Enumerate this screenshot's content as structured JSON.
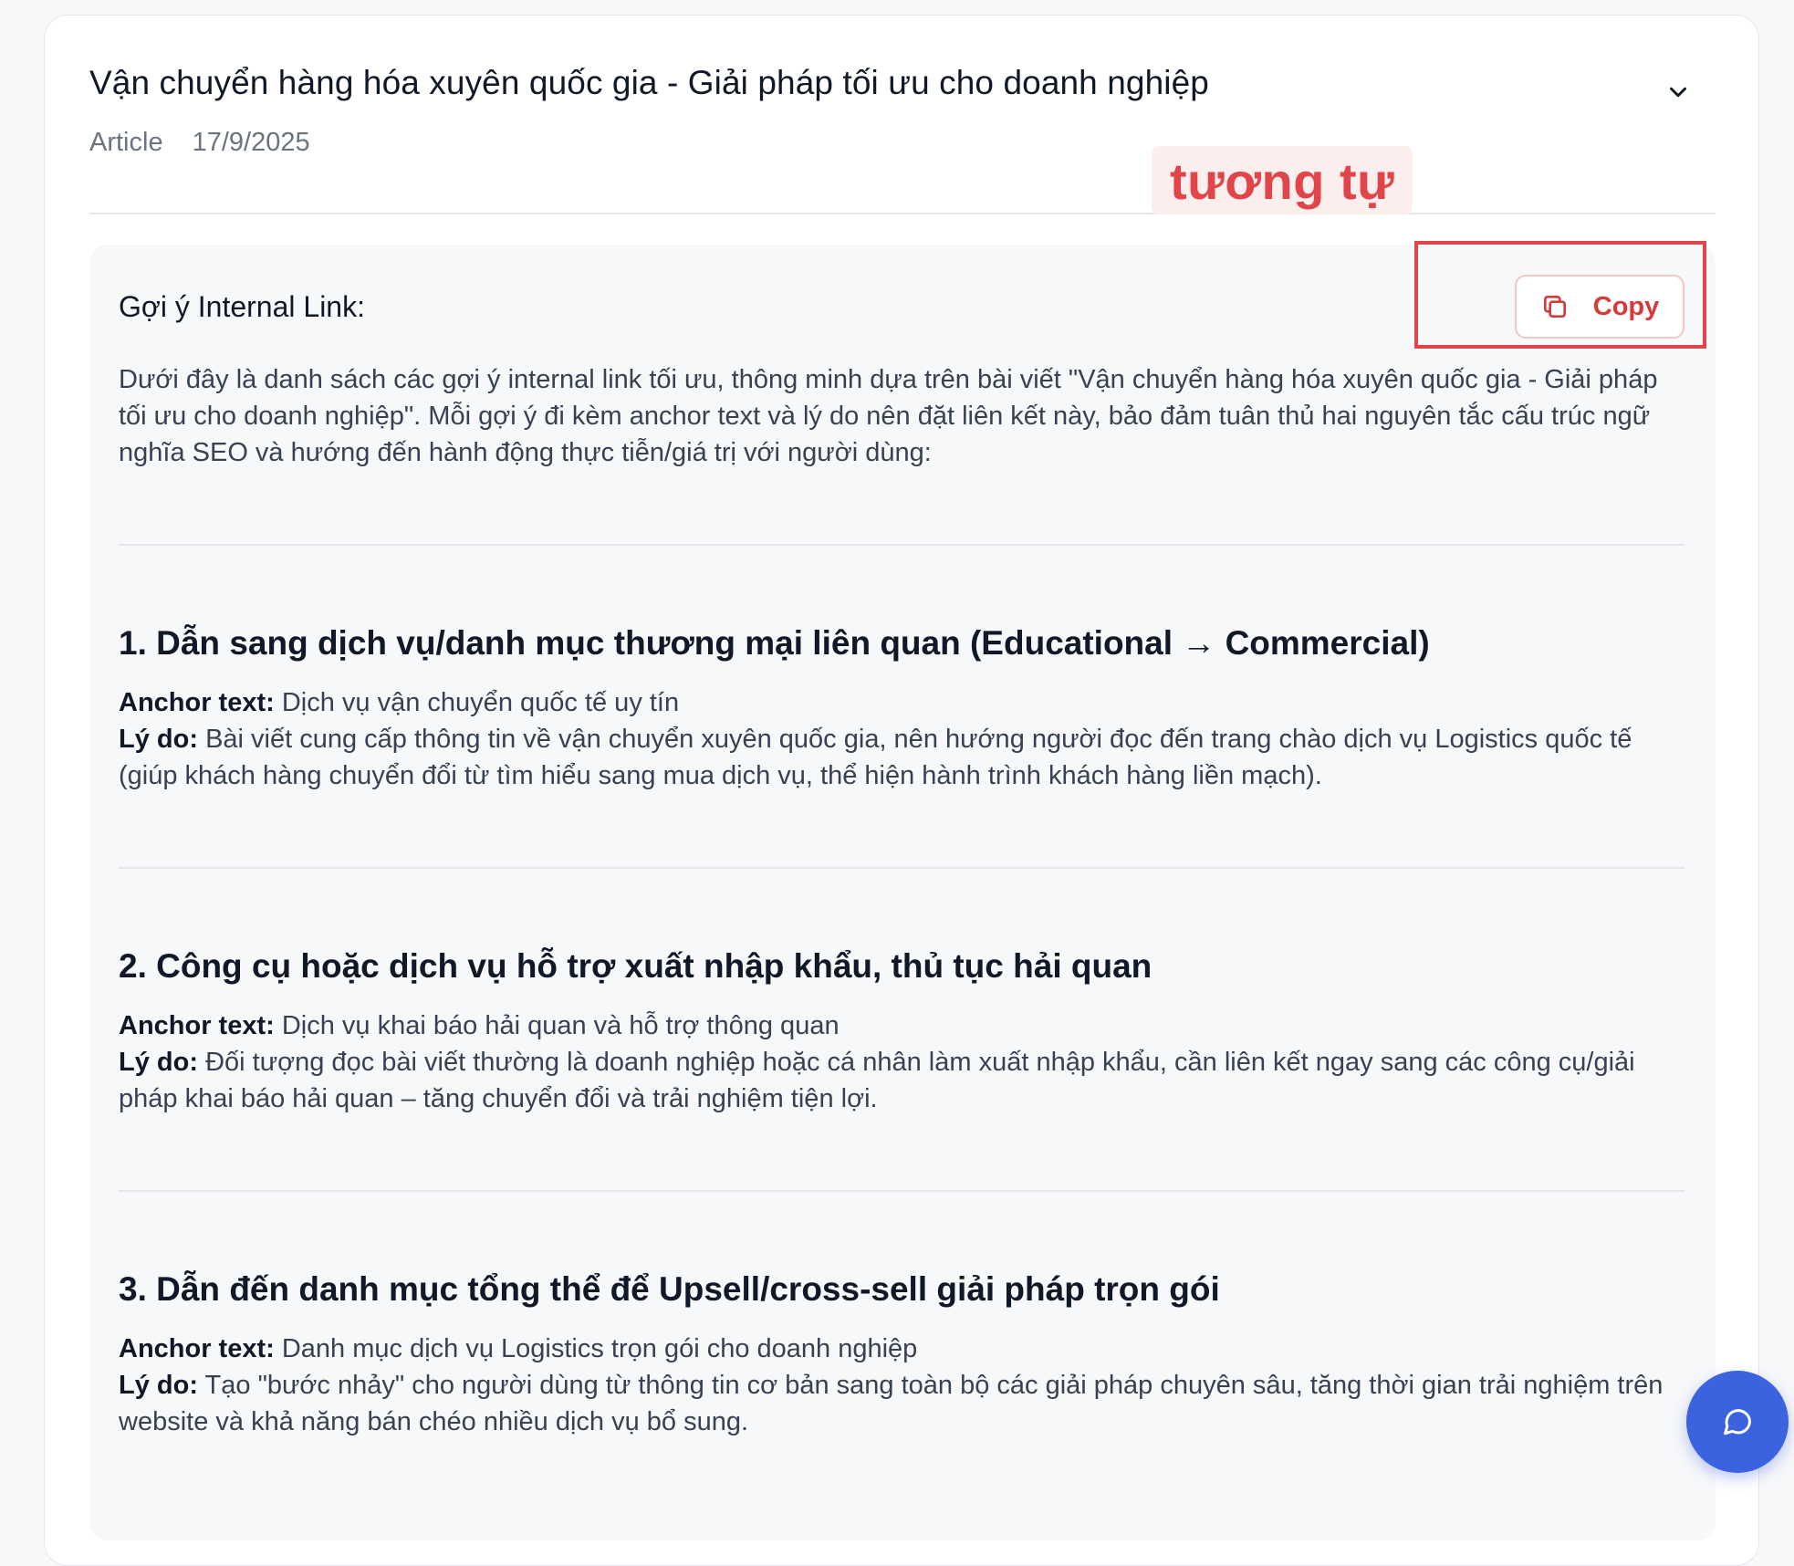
{
  "article": {
    "title": "Vận chuyển hàng hóa xuyên quốc gia - Giải pháp tối ưu cho doanh nghiệp",
    "type": "Article",
    "date": "17/9/2025"
  },
  "annotation": {
    "text": "tương tự"
  },
  "panel": {
    "heading": "Gợi ý Internal Link:",
    "copy_label": "Copy",
    "intro": "Dưới đây là danh sách các gợi ý internal link tối ưu, thông minh dựa trên bài viết \"Vận chuyển hàng hóa xuyên quốc gia - Giải pháp tối ưu cho doanh nghiệp\". Mỗi gợi ý đi kèm anchor text và lý do nên đặt liên kết này, bảo đảm tuân thủ hai nguyên tắc cấu trúc ngữ nghĩa SEO và hướng đến hành động thực tiễn/giá trị với người dùng:",
    "anchor_label": "Anchor text:",
    "reason_label": "Lý do:",
    "sections": [
      {
        "title": "1. Dẫn sang dịch vụ/danh mục thương mại liên quan (Educational → Commercial)",
        "anchor": "Dịch vụ vận chuyển quốc tế uy tín",
        "reason": "Bài viết cung cấp thông tin về vận chuyển xuyên quốc gia, nên hướng người đọc đến trang chào dịch vụ Logistics quốc tế (giúp khách hàng chuyển đổi từ tìm hiểu sang mua dịch vụ, thể hiện hành trình khách hàng liền mạch)."
      },
      {
        "title": "2. Công cụ hoặc dịch vụ hỗ trợ xuất nhập khẩu, thủ tục hải quan",
        "anchor": "Dịch vụ khai báo hải quan và hỗ trợ thông quan",
        "reason": "Đối tượng đọc bài viết thường là doanh nghiệp hoặc cá nhân làm xuất nhập khẩu, cần liên kết ngay sang các công cụ/giải pháp khai báo hải quan – tăng chuyển đổi và trải nghiệm tiện lợi."
      },
      {
        "title": "3. Dẫn đến danh mục tổng thể để Upsell/cross-sell giải pháp trọn gói",
        "anchor": "Danh mục dịch vụ Logistics trọn gói cho doanh nghiệp",
        "reason": "Tạo \"bước nhảy\" cho người dùng từ thông tin cơ bản sang toàn bộ các giải pháp chuyên sâu, tăng thời gian trải nghiệm trên website và khả năng bán chéo nhiều dịch vụ bổ sung."
      }
    ]
  },
  "icons": {
    "expand": "chevron-down-icon",
    "copy": "copy-icon",
    "chat": "chat-bubble-icon"
  },
  "colors": {
    "accent_red": "#e0454a",
    "fab_blue": "#3b63e0"
  }
}
